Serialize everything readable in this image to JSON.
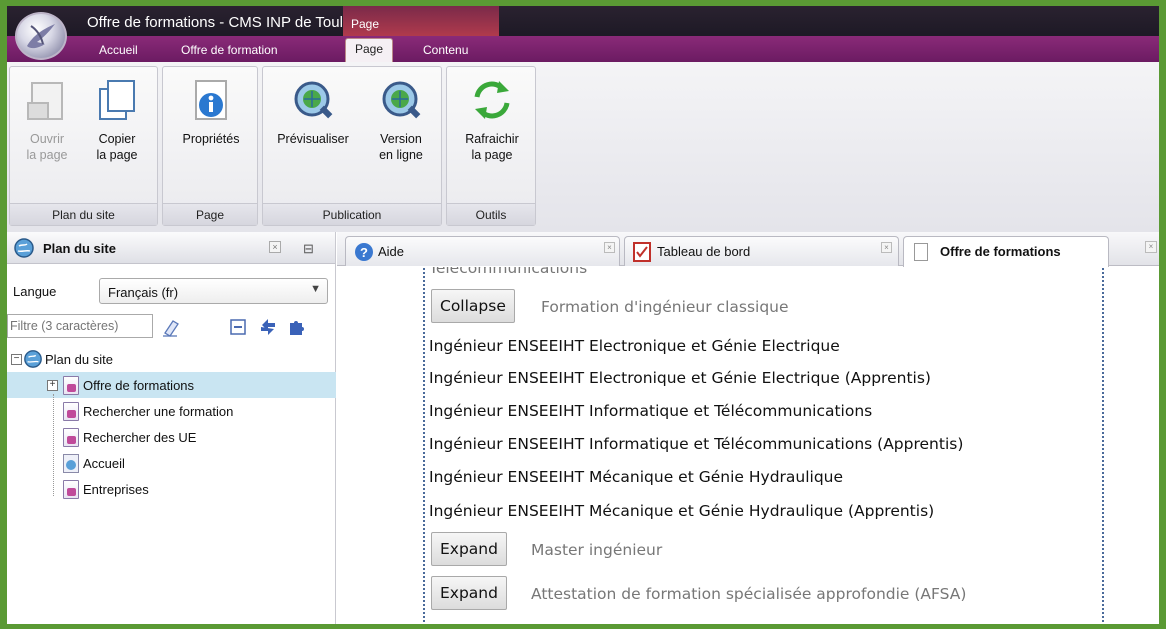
{
  "window": {
    "title": "Offre de formations - CMS INP de Toulouse",
    "context_tab": "Page"
  },
  "menu": {
    "tabs": [
      "Accueil",
      "Offre de formation",
      "Page",
      "Contenu"
    ],
    "active": "Page"
  },
  "ribbon": {
    "groups": [
      {
        "label": "Plan du site",
        "buttons": [
          {
            "line1": "Ouvrir",
            "line2": "la page",
            "disabled": true,
            "icon": "open-page-icon"
          },
          {
            "line1": "Copier",
            "line2": "la page",
            "disabled": false,
            "icon": "copy-page-icon"
          }
        ]
      },
      {
        "label": "Page",
        "buttons": [
          {
            "line1": "Propriétés",
            "line2": "",
            "disabled": false,
            "icon": "info-icon"
          }
        ]
      },
      {
        "label": "Publication",
        "buttons": [
          {
            "line1": "Prévisualiser",
            "line2": "",
            "disabled": false,
            "icon": "globe-magnifier-icon"
          },
          {
            "line1": "Version",
            "line2": "en ligne",
            "disabled": false,
            "icon": "globe-magnifier-icon"
          }
        ]
      },
      {
        "label": "Outils",
        "buttons": [
          {
            "line1": "Rafraichir",
            "line2": "la page",
            "disabled": false,
            "icon": "refresh-icon"
          }
        ]
      }
    ]
  },
  "sidebar": {
    "title": "Plan du site",
    "language_label": "Langue",
    "language_value": "Français (fr)",
    "filter_placeholder": "Filtre (3 caractères)",
    "tree": {
      "root": "Plan du site",
      "items": [
        {
          "label": "Offre de formations",
          "selected": true,
          "expandable": true
        },
        {
          "label": "Rechercher une formation",
          "selected": false,
          "expandable": false
        },
        {
          "label": "Rechercher des UE",
          "selected": false,
          "expandable": false
        },
        {
          "label": "Accueil",
          "selected": false,
          "expandable": false
        },
        {
          "label": "Entreprises",
          "selected": false,
          "expandable": false
        }
      ]
    }
  },
  "doc_tabs": [
    {
      "label": "Aide",
      "active": false,
      "icon": "help-icon"
    },
    {
      "label": "Tableau de bord",
      "active": false,
      "icon": "dashboard-icon"
    },
    {
      "label": "Offre de formations",
      "active": true,
      "icon": "page-icon"
    }
  ],
  "content": {
    "partial_top": "Télécommunications",
    "section1": {
      "button": "Collapse",
      "label": "Formation d'ingénieur classique"
    },
    "items": [
      "Ingénieur ENSEEIHT Electronique et Génie Electrique",
      "Ingénieur ENSEEIHT Electronique et Génie Electrique (Apprentis)",
      "Ingénieur ENSEEIHT Informatique et Télécommunications",
      "Ingénieur ENSEEIHT Informatique et Télécommunications (Apprentis)",
      "Ingénieur ENSEEIHT Mécanique et Génie Hydraulique",
      "Ingénieur ENSEEIHT Mécanique et Génie Hydraulique (Apprentis)"
    ],
    "section2": {
      "button": "Expand",
      "label": "Master ingénieur"
    },
    "section3": {
      "button": "Expand",
      "label": "Attestation de formation spécialisée approfondie (AFSA)"
    }
  },
  "colors": {
    "frame_border": "#5a9a34",
    "menu_bar": "#7a2270",
    "selection": "#c9e5f2",
    "dotted_border": "#4a6a9a"
  }
}
